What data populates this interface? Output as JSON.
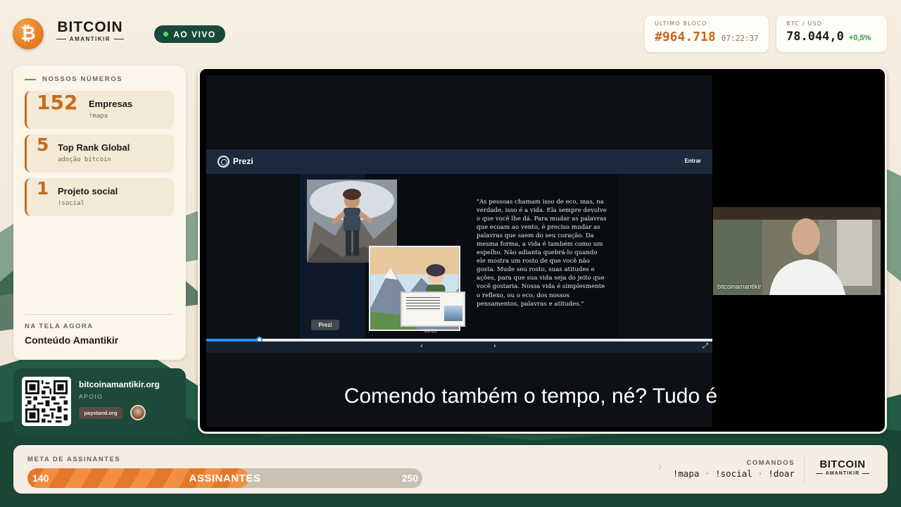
{
  "brand": {
    "coin_symbol": "₿",
    "title": "BITCOIN",
    "subtitle": "AMANTIKIR"
  },
  "live": {
    "label": "AO VIVO",
    "color": "#5cd65c"
  },
  "last_block": {
    "label": "ÚLTIMO BLOCO",
    "number": "#964.718",
    "time": "07:22:37"
  },
  "btc": {
    "label": "BTC / USD",
    "price": "78.044,0",
    "change": "+0,5%"
  },
  "numbers": {
    "title": "NOSSOS NÚMEROS",
    "items": [
      {
        "value": "152",
        "label": "Empresas",
        "command": "!mapa"
      },
      {
        "value": "5",
        "label": "Top Rank Global",
        "command": "adoção bitcoin"
      },
      {
        "value": "1",
        "label": "Projeto social",
        "command": "!social"
      }
    ]
  },
  "now_showing": {
    "label": "NA TELA AGORA",
    "value": "Conteúdo Amantikir"
  },
  "support": {
    "site": "bitcoinamantikir.org",
    "label": "APOIO",
    "partner": "paystand.org"
  },
  "stream": {
    "app_name": "Prezi",
    "login_label": "Entrar",
    "quote": "\"As pessoas chamam isso de eco, mas, na verdade, isso é a vida. Ela sempre devolve o que você lhe dá. Para mudar as palavras que ecoam ao vento, é preciso mudar as palavras que saem do seu coração. Da mesma forma, a vida é também como um espelho. Não adianta quebrá-lo quando ele mostra um rosto de que você não gosta. Mude seu rosto, suas atitudes e ações, para que sua vida seja do jeito que você gostaria. Nossa vida é simplesmente o reflexo, ou o eco, dos nossos pensamentos, palavras e atitudes.\"",
    "page_counter": "18/39",
    "prezi_badge": "Prezi",
    "progress": 0.105,
    "prev_icon": "‹",
    "next_icon": "›",
    "fullscreen_icon": "⤢",
    "subtitle": "Comendo também o tempo, né? Tudo é",
    "webcam_name": "bitcoinamantikir"
  },
  "goal": {
    "label": "META DE ASSINANTES",
    "current": 140,
    "target": 250,
    "center_label": "ASSINANTES",
    "fill_color": "#e5762a"
  },
  "commands": {
    "label": "COMANDOS",
    "items": [
      "!mapa",
      "!social",
      "!doar"
    ]
  },
  "footer_brand": {
    "title": "BITCOIN",
    "subtitle": "AMANTIKIR"
  }
}
